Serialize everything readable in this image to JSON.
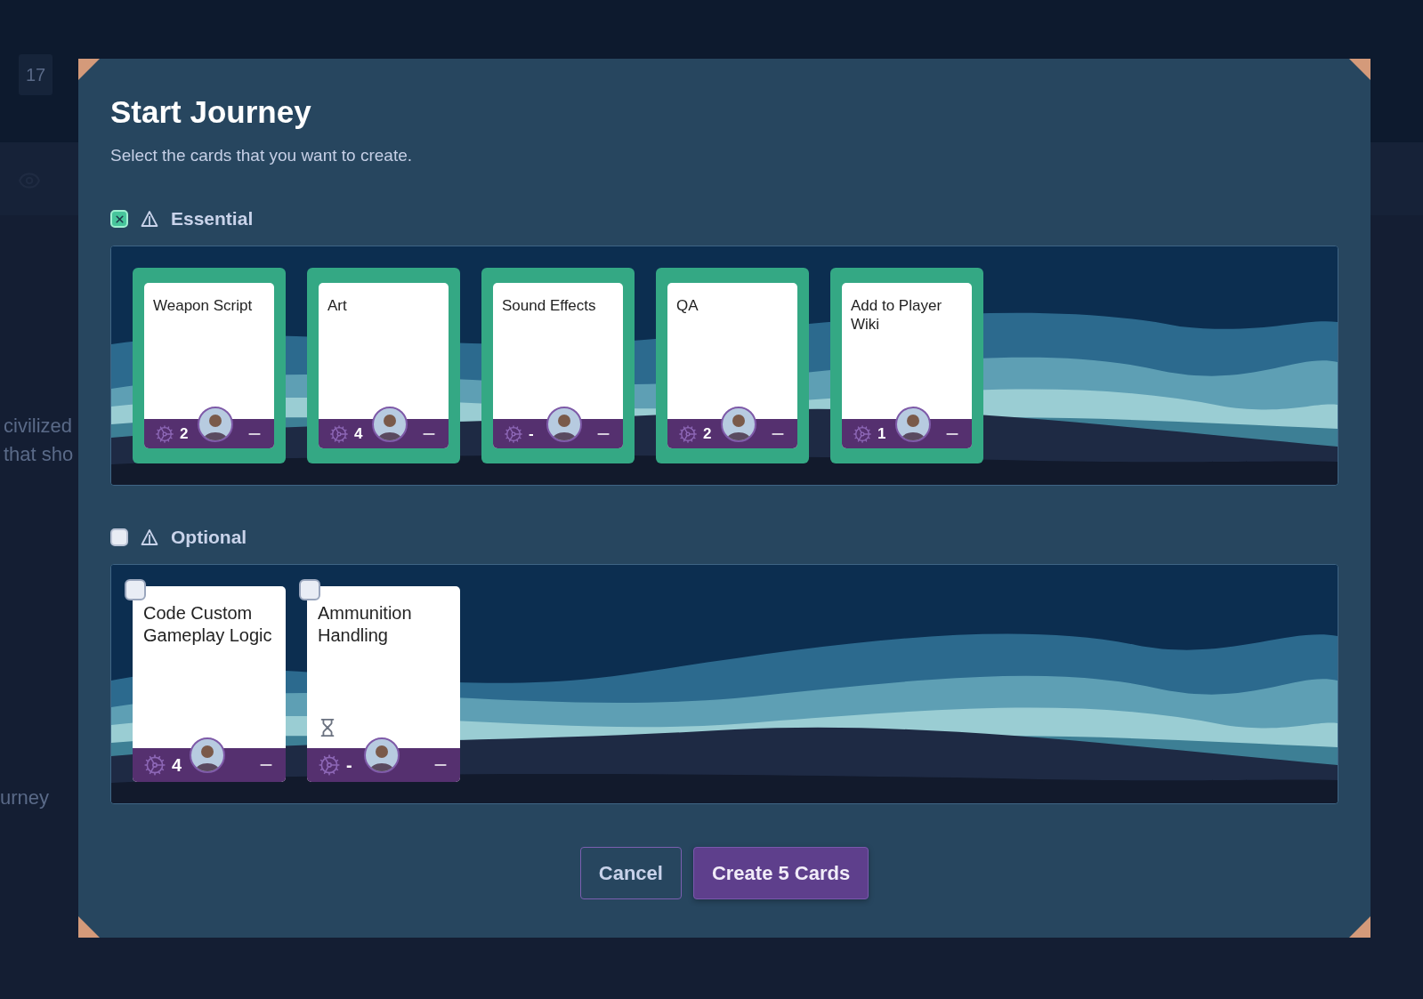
{
  "background": {
    "badge": "17",
    "lines": [
      "civilized",
      "that sho"
    ],
    "tab": "urney"
  },
  "dialog": {
    "title": "Start Journey",
    "subtitle": "Select the cards that you want to create.",
    "sections": [
      {
        "title": "Essential",
        "checked": true,
        "cards": [
          {
            "title": "Weapon Script",
            "count": "2",
            "selected": true,
            "waiting": false
          },
          {
            "title": "Art",
            "count": "4",
            "selected": true,
            "waiting": false
          },
          {
            "title": "Sound Effects",
            "count": "-",
            "selected": true,
            "waiting": false
          },
          {
            "title": "QA",
            "count": "2",
            "selected": true,
            "waiting": false
          },
          {
            "title": "Add to Player Wiki",
            "count": "1",
            "selected": true,
            "waiting": false
          }
        ]
      },
      {
        "title": "Optional",
        "checked": false,
        "cards": [
          {
            "title": "Code Custom Gameplay Logic",
            "count": "4",
            "selected": false,
            "waiting": false
          },
          {
            "title": "Ammunition Handling",
            "count": "-",
            "selected": false,
            "waiting": true
          }
        ]
      }
    ],
    "buttons": [
      {
        "label": "Cancel",
        "kind": "secondary"
      },
      {
        "label": "Create 5 Cards",
        "kind": "primary"
      }
    ]
  }
}
